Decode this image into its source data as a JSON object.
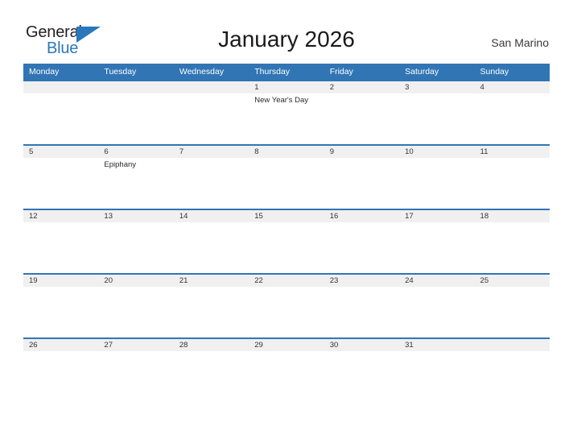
{
  "brand": {
    "name_part1": "General",
    "name_part2": "Blue",
    "flag_icon": "blue-flag-triangle",
    "color_dark": "#231f20",
    "color_blue": "#2a77bb"
  },
  "header": {
    "title": "January 2026",
    "region": "San Marino"
  },
  "calendar": {
    "accent_color": "#3175b4",
    "band_color": "#f0f0f0",
    "weekday_headers": [
      "Monday",
      "Tuesday",
      "Wednesday",
      "Thursday",
      "Friday",
      "Saturday",
      "Sunday"
    ],
    "weeks": [
      [
        {
          "day": "",
          "events": []
        },
        {
          "day": "",
          "events": []
        },
        {
          "day": "",
          "events": []
        },
        {
          "day": "1",
          "events": [
            "New Year's Day"
          ]
        },
        {
          "day": "2",
          "events": []
        },
        {
          "day": "3",
          "events": []
        },
        {
          "day": "4",
          "events": []
        }
      ],
      [
        {
          "day": "5",
          "events": []
        },
        {
          "day": "6",
          "events": [
            "Epiphany"
          ]
        },
        {
          "day": "7",
          "events": []
        },
        {
          "day": "8",
          "events": []
        },
        {
          "day": "9",
          "events": []
        },
        {
          "day": "10",
          "events": []
        },
        {
          "day": "11",
          "events": []
        }
      ],
      [
        {
          "day": "12",
          "events": []
        },
        {
          "day": "13",
          "events": []
        },
        {
          "day": "14",
          "events": []
        },
        {
          "day": "15",
          "events": []
        },
        {
          "day": "16",
          "events": []
        },
        {
          "day": "17",
          "events": []
        },
        {
          "day": "18",
          "events": []
        }
      ],
      [
        {
          "day": "19",
          "events": []
        },
        {
          "day": "20",
          "events": []
        },
        {
          "day": "21",
          "events": []
        },
        {
          "day": "22",
          "events": []
        },
        {
          "day": "23",
          "events": []
        },
        {
          "day": "24",
          "events": []
        },
        {
          "day": "25",
          "events": []
        }
      ],
      [
        {
          "day": "26",
          "events": []
        },
        {
          "day": "27",
          "events": []
        },
        {
          "day": "28",
          "events": []
        },
        {
          "day": "29",
          "events": []
        },
        {
          "day": "30",
          "events": []
        },
        {
          "day": "31",
          "events": []
        },
        {
          "day": "",
          "events": []
        }
      ]
    ]
  }
}
